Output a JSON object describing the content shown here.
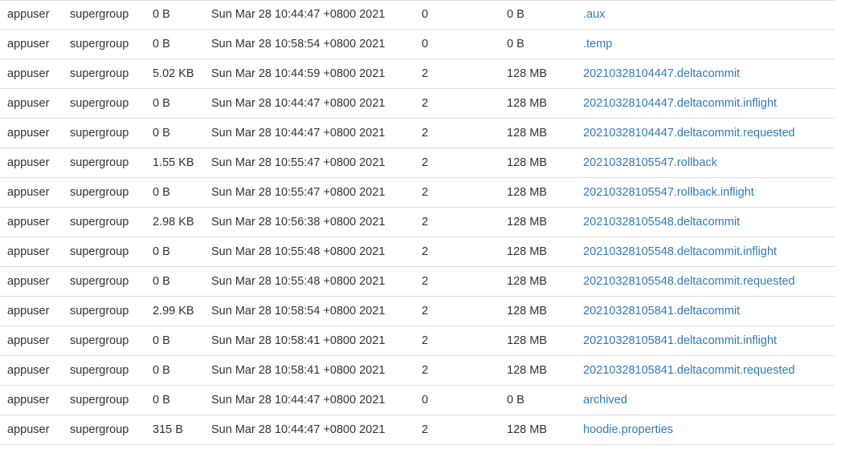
{
  "listing": {
    "rows": [
      {
        "owner": "appuser",
        "group": "supergroup",
        "size": "0 B",
        "last_modified": "Sun Mar 28 10:44:47 +0800 2021",
        "replication": "0",
        "block_size": "0 B",
        "name": ".aux"
      },
      {
        "owner": "appuser",
        "group": "supergroup",
        "size": "0 B",
        "last_modified": "Sun Mar 28 10:58:54 +0800 2021",
        "replication": "0",
        "block_size": "0 B",
        "name": ".temp"
      },
      {
        "owner": "appuser",
        "group": "supergroup",
        "size": "5.02 KB",
        "last_modified": "Sun Mar 28 10:44:59 +0800 2021",
        "replication": "2",
        "block_size": "128 MB",
        "name": "20210328104447.deltacommit"
      },
      {
        "owner": "appuser",
        "group": "supergroup",
        "size": "0 B",
        "last_modified": "Sun Mar 28 10:44:47 +0800 2021",
        "replication": "2",
        "block_size": "128 MB",
        "name": "20210328104447.deltacommit.inflight"
      },
      {
        "owner": "appuser",
        "group": "supergroup",
        "size": "0 B",
        "last_modified": "Sun Mar 28 10:44:47 +0800 2021",
        "replication": "2",
        "block_size": "128 MB",
        "name": "20210328104447.deltacommit.requested"
      },
      {
        "owner": "appuser",
        "group": "supergroup",
        "size": "1.55 KB",
        "last_modified": "Sun Mar 28 10:55:47 +0800 2021",
        "replication": "2",
        "block_size": "128 MB",
        "name": "20210328105547.rollback"
      },
      {
        "owner": "appuser",
        "group": "supergroup",
        "size": "0 B",
        "last_modified": "Sun Mar 28 10:55:47 +0800 2021",
        "replication": "2",
        "block_size": "128 MB",
        "name": "20210328105547.rollback.inflight"
      },
      {
        "owner": "appuser",
        "group": "supergroup",
        "size": "2.98 KB",
        "last_modified": "Sun Mar 28 10:56:38 +0800 2021",
        "replication": "2",
        "block_size": "128 MB",
        "name": "20210328105548.deltacommit"
      },
      {
        "owner": "appuser",
        "group": "supergroup",
        "size": "0 B",
        "last_modified": "Sun Mar 28 10:55:48 +0800 2021",
        "replication": "2",
        "block_size": "128 MB",
        "name": "20210328105548.deltacommit.inflight"
      },
      {
        "owner": "appuser",
        "group": "supergroup",
        "size": "0 B",
        "last_modified": "Sun Mar 28 10:55:48 +0800 2021",
        "replication": "2",
        "block_size": "128 MB",
        "name": "20210328105548.deltacommit.requested"
      },
      {
        "owner": "appuser",
        "group": "supergroup",
        "size": "2.99 KB",
        "last_modified": "Sun Mar 28 10:58:54 +0800 2021",
        "replication": "2",
        "block_size": "128 MB",
        "name": "20210328105841.deltacommit"
      },
      {
        "owner": "appuser",
        "group": "supergroup",
        "size": "0 B",
        "last_modified": "Sun Mar 28 10:58:41 +0800 2021",
        "replication": "2",
        "block_size": "128 MB",
        "name": "20210328105841.deltacommit.inflight"
      },
      {
        "owner": "appuser",
        "group": "supergroup",
        "size": "0 B",
        "last_modified": "Sun Mar 28 10:58:41 +0800 2021",
        "replication": "2",
        "block_size": "128 MB",
        "name": "20210328105841.deltacommit.requested"
      },
      {
        "owner": "appuser",
        "group": "supergroup",
        "size": "0 B",
        "last_modified": "Sun Mar 28 10:44:47 +0800 2021",
        "replication": "0",
        "block_size": "0 B",
        "name": "archived"
      },
      {
        "owner": "appuser",
        "group": "supergroup",
        "size": "315 B",
        "last_modified": "Sun Mar 28 10:44:47 +0800 2021",
        "replication": "2",
        "block_size": "128 MB",
        "name": "hoodie.properties"
      }
    ]
  },
  "colors": {
    "text": "#333333",
    "link": "#337ab7",
    "row_border": "#dddddd",
    "background": "#ffffff"
  }
}
